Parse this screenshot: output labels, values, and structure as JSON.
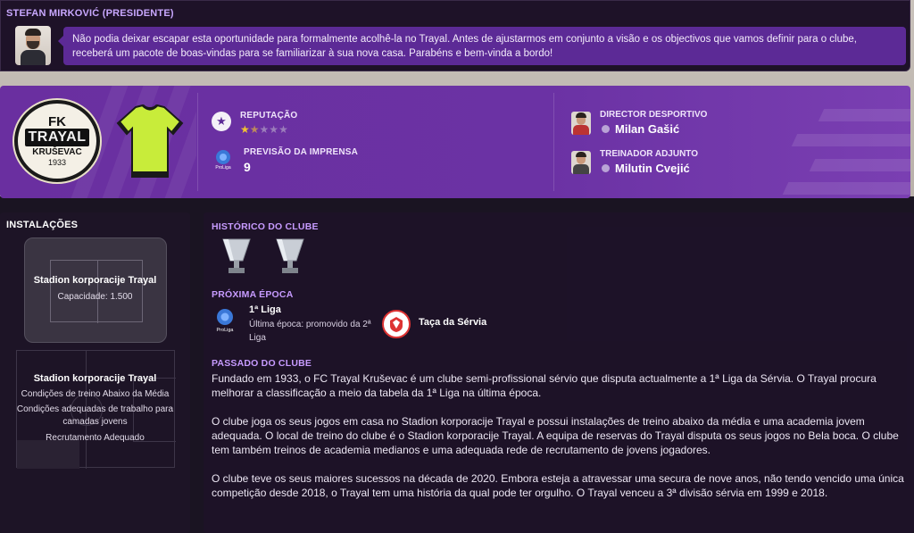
{
  "message": {
    "from": "STEFAN MIRKOVIĆ (PRESIDENTE)",
    "text": "Não podia deixar escapar esta oportunidade para formalmente acolhê-la no Trayal. Antes de ajustarmos em conjunto a visão e os objectivos que vamos definir para o clube, receberá um pacote de boas-vindas para se familiarizar à sua nova casa. Parabéns e bem-vinda a bordo!"
  },
  "club": {
    "crest": {
      "fk": "FK",
      "name": "TRAYAL",
      "city": "KRUŠEVAC",
      "year": "1933"
    },
    "colors": {
      "shirt": "#c8ec3a",
      "trim": "#1a1a1a",
      "header": "#6b32a4",
      "accent": "#c79bff"
    },
    "reputation_label": "REPUTAÇÃO",
    "reputation_stars": 1.5,
    "reputation_max": 5,
    "press_label": "PREVISÃO DA IMPRENSA",
    "press_value": "9"
  },
  "staff": {
    "director_label": "DIRECTOR DESPORTIVO",
    "director_name": "Milan Gašić",
    "assistant_label": "TREINADOR ADJUNTO",
    "assistant_name": "Milutin Cvejić"
  },
  "facilities": {
    "title": "INSTALAÇÕES",
    "stadium_name": "Stadion korporacije Trayal",
    "stadium_capacity": "Capacidade: 1.500",
    "training_name": "Stadion korporacije Trayal",
    "training_lines": [
      "Condições de treino Abaixo da Média",
      "Condições adequadas de trabalho para",
      "camadas jovens",
      "Recrutamento Adequado"
    ]
  },
  "history": {
    "title": "HISTÓRICO DO CLUBE",
    "trophy_icons": [
      "trophy-icon",
      "trophy-icon"
    ],
    "next_season_title": "PRÓXIMA ÉPOCA",
    "league_name": "1ª Liga",
    "league_sub": "Última época: promovido da 2ª Liga",
    "cup_name": "Taça da Sérvia",
    "past_title": "PASSADO DO CLUBE",
    "paragraphs": [
      "Fundado em 1933, o FC Trayal Kruševac é um clube semi-profissional sérvio que disputa actualmente a 1ª Liga da Sérvia. O Trayal procura melhorar a classificação a meio da tabela da 1ª Liga na última época.",
      "O clube joga os seus jogos em casa no Stadion korporacije Trayal e possui instalações de treino abaixo da média e uma academia jovem adequada. O local de treino do clube é o Stadion korporacije Trayal. A equipa de reservas do Trayal disputa os seus jogos no Bela boca. O clube tem também treinos de academia medianos e uma adequada rede de recrutamento de jovens jogadores.",
      "O clube teve os seus maiores sucessos na década de 2020. Embora esteja a atravessar uma secura de nove anos, não tendo vencido uma única competição desde 2018, o Trayal tem uma história da qual pode ter orgulho. O Trayal venceu a 3ª divisão sérvia em 1999 e 2018."
    ]
  }
}
